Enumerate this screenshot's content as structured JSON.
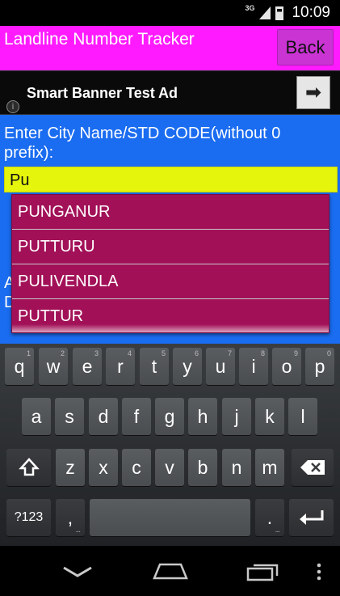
{
  "status_bar": {
    "network": "3G",
    "time": "10:09"
  },
  "header": {
    "title": "Landline Number Tracker",
    "back_label": "Back"
  },
  "ad": {
    "text": "Smart Banner Test Ad",
    "info_glyph": "i",
    "arrow_glyph": "➡"
  },
  "form": {
    "prompt_line1": "Enter City Name/STD CODE(without 0",
    "prompt_line2": "prefix):",
    "input_value": "Pu",
    "partial_hidden_line1": "A",
    "partial_hidden_line2": "D"
  },
  "suggestions": [
    "PUNGANUR",
    "PUTTURU",
    "PULIVENDLA",
    "PUTTUR"
  ],
  "keyboard": {
    "row1": [
      {
        "k": "q",
        "h": "1"
      },
      {
        "k": "w",
        "h": "2"
      },
      {
        "k": "e",
        "h": "3"
      },
      {
        "k": "r",
        "h": "4"
      },
      {
        "k": "t",
        "h": "5"
      },
      {
        "k": "y",
        "h": "6"
      },
      {
        "k": "u",
        "h": "7"
      },
      {
        "k": "i",
        "h": "8"
      },
      {
        "k": "o",
        "h": "9"
      },
      {
        "k": "p",
        "h": "0"
      }
    ],
    "row2": [
      "a",
      "s",
      "d",
      "f",
      "g",
      "h",
      "j",
      "k",
      "l"
    ],
    "row3": [
      "z",
      "x",
      "c",
      "v",
      "b",
      "n",
      "m"
    ],
    "symbols_label": "?123",
    "comma": ",",
    "period": "."
  },
  "icons": {
    "shift": "shift-icon",
    "backspace": "backspace-icon",
    "enter": "enter-icon",
    "back": "nav-back-icon",
    "home": "nav-home-icon",
    "recents": "nav-recents-icon",
    "menu": "nav-menu-icon"
  },
  "colors": {
    "header_bg": "#ff1aff",
    "back_button": "#c934d3",
    "content_bg": "#1a6cf0",
    "input_bg": "#e6f50c",
    "dropdown_bg": "#a21158"
  }
}
